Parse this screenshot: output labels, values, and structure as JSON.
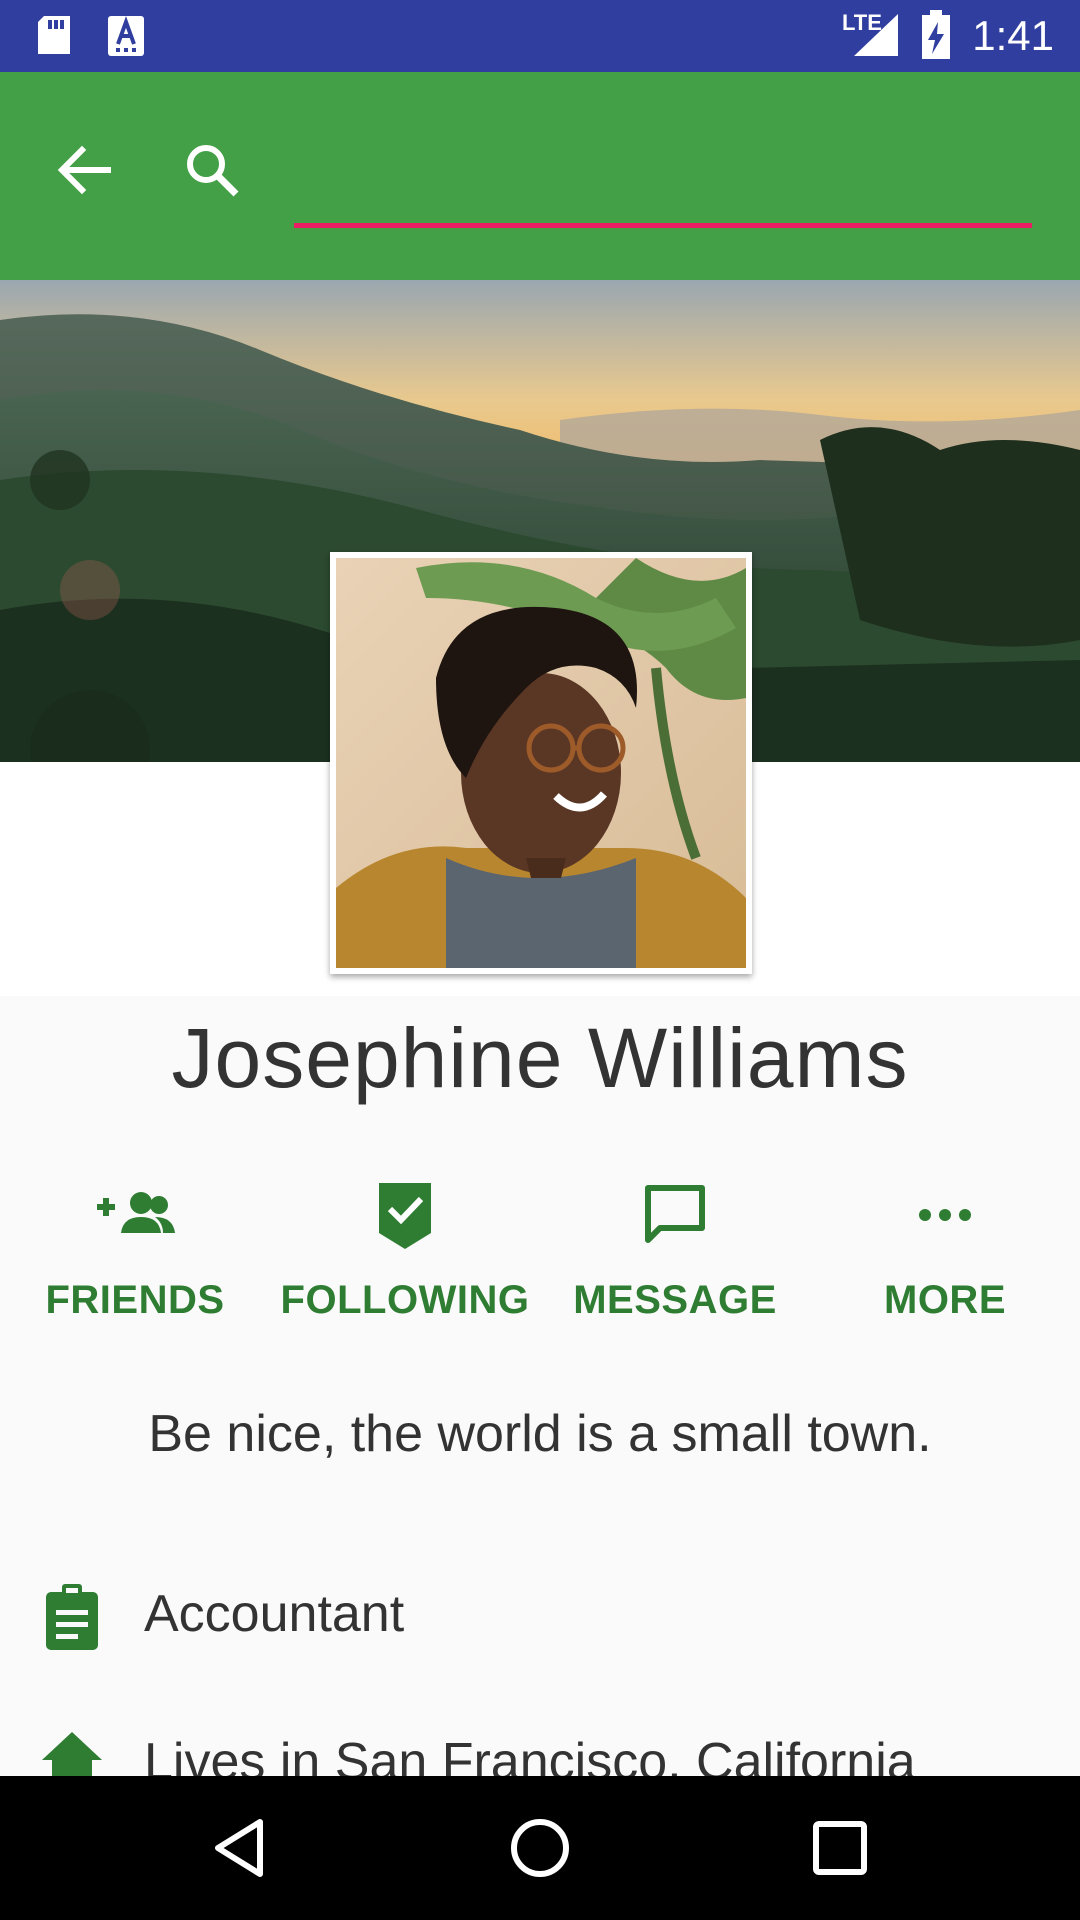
{
  "status_bar": {
    "time": "1:41",
    "network_label": "LTE",
    "icons": [
      "sd-card-icon",
      "keyboard-a-icon",
      "signal-icon",
      "battery-charging-icon"
    ]
  },
  "app_bar": {
    "back_icon": "arrow-back-icon",
    "search_icon": "search-icon",
    "search_value": "",
    "accent_color": "#43a047",
    "underline_color": "#e91e63"
  },
  "profile": {
    "name": "Josephine Williams",
    "tagline": "Be nice, the world is a small town."
  },
  "actions": [
    {
      "label": "FRIENDS",
      "icon": "add-friend-icon"
    },
    {
      "label": "FOLLOWING",
      "icon": "following-check-icon"
    },
    {
      "label": "MESSAGE",
      "icon": "message-icon"
    },
    {
      "label": "MORE",
      "icon": "more-horiz-icon"
    }
  ],
  "info": [
    {
      "text": "Accountant",
      "icon": "clipboard-icon"
    },
    {
      "text": "Lives in San Francisco, California",
      "icon": "home-icon"
    }
  ],
  "nav_bar": {
    "buttons": [
      "back-triangle-icon",
      "home-circle-icon",
      "recents-square-icon"
    ]
  },
  "colors": {
    "status_bar": "#303f9f",
    "action_green": "#2e7d32"
  }
}
